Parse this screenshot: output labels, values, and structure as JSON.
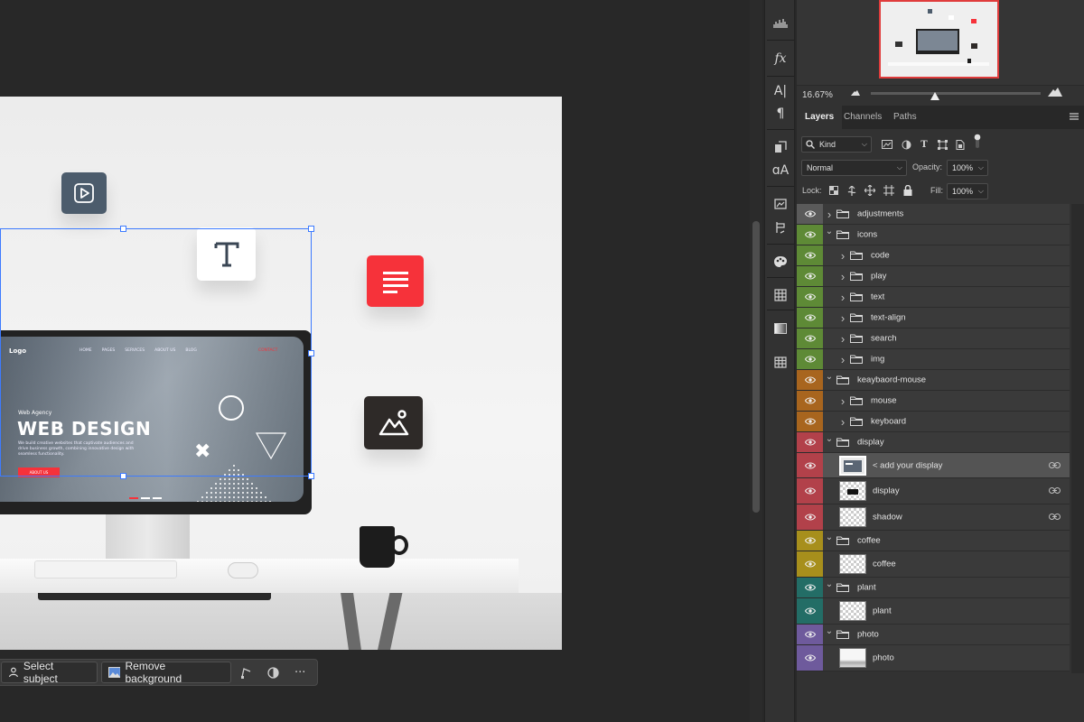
{
  "mockup": {
    "site_logo": "Logo",
    "nav_items": [
      "HOME",
      "PAGES",
      "SERVICES",
      "ABOUT US",
      "BLOG"
    ],
    "nav_cta": "CONTACT",
    "tagline": "Web Agency",
    "hero_title": "WEB DESIGN",
    "hero_copy": "We build creative websites that captivate audiences and drive business growth, combining innovative design with seamless functionality.",
    "cta_button": "ABOUT US"
  },
  "taskbar": {
    "select_subject": "Select subject",
    "remove_background": "Remove background",
    "more": "···"
  },
  "navigator": {
    "zoom": "16.67%",
    "zoom_level": 0.38
  },
  "layers_panel": {
    "tabs": [
      "Layers",
      "Channels",
      "Paths"
    ],
    "active_tab": "Layers",
    "filter_kind": "Kind",
    "blend_mode": "Normal",
    "opacity_label": "Opacity:",
    "opacity_value": "100%",
    "lock_label": "Lock:",
    "fill_label": "Fill:",
    "fill_value": "100%",
    "layers": [
      {
        "name": "adjustments",
        "type": "group",
        "depth": 0,
        "collapsed": true,
        "color": "#5a5a5a"
      },
      {
        "name": "icons",
        "type": "group",
        "depth": 0,
        "collapsed": false,
        "color": "#5e8a36"
      },
      {
        "name": "code",
        "type": "group",
        "depth": 1,
        "collapsed": true,
        "color": "#5e8a36"
      },
      {
        "name": "play",
        "type": "group",
        "depth": 1,
        "collapsed": true,
        "color": "#5e8a36"
      },
      {
        "name": "text",
        "type": "group",
        "depth": 1,
        "collapsed": true,
        "color": "#5e8a36"
      },
      {
        "name": "text-align",
        "type": "group",
        "depth": 1,
        "collapsed": true,
        "color": "#5e8a36"
      },
      {
        "name": "search",
        "type": "group",
        "depth": 1,
        "collapsed": true,
        "color": "#5e8a36"
      },
      {
        "name": "img",
        "type": "group",
        "depth": 1,
        "collapsed": true,
        "color": "#5e8a36"
      },
      {
        "name": "keaybaord-mouse",
        "type": "group",
        "depth": 0,
        "collapsed": false,
        "color": "#a8651e"
      },
      {
        "name": "mouse",
        "type": "group",
        "depth": 1,
        "collapsed": true,
        "color": "#a8651e"
      },
      {
        "name": "keyboard",
        "type": "group",
        "depth": 1,
        "collapsed": true,
        "color": "#a8651e"
      },
      {
        "name": "display",
        "type": "group",
        "depth": 0,
        "collapsed": false,
        "color": "#b2414a"
      },
      {
        "name": "< add your display",
        "type": "smart",
        "depth": 1,
        "selected": true,
        "linked": true,
        "color": "#b2414a"
      },
      {
        "name": "display",
        "type": "layer",
        "depth": 1,
        "linked": true,
        "color": "#b2414a"
      },
      {
        "name": "shadow",
        "type": "layer",
        "depth": 1,
        "linked": true,
        "color": "#b2414a"
      },
      {
        "name": "coffee",
        "type": "group",
        "depth": 0,
        "collapsed": false,
        "color": "#a78f1c"
      },
      {
        "name": "coffee",
        "type": "layer",
        "depth": 1,
        "color": "#a78f1c"
      },
      {
        "name": "plant",
        "type": "group",
        "depth": 0,
        "collapsed": false,
        "color": "#236d66"
      },
      {
        "name": "plant",
        "type": "layer",
        "depth": 1,
        "color": "#236d66"
      },
      {
        "name": "photo",
        "type": "group",
        "depth": 0,
        "collapsed": false,
        "color": "#6e5a9c"
      },
      {
        "name": "photo",
        "type": "layer",
        "depth": 1,
        "color": "#6e5a9c"
      }
    ]
  }
}
